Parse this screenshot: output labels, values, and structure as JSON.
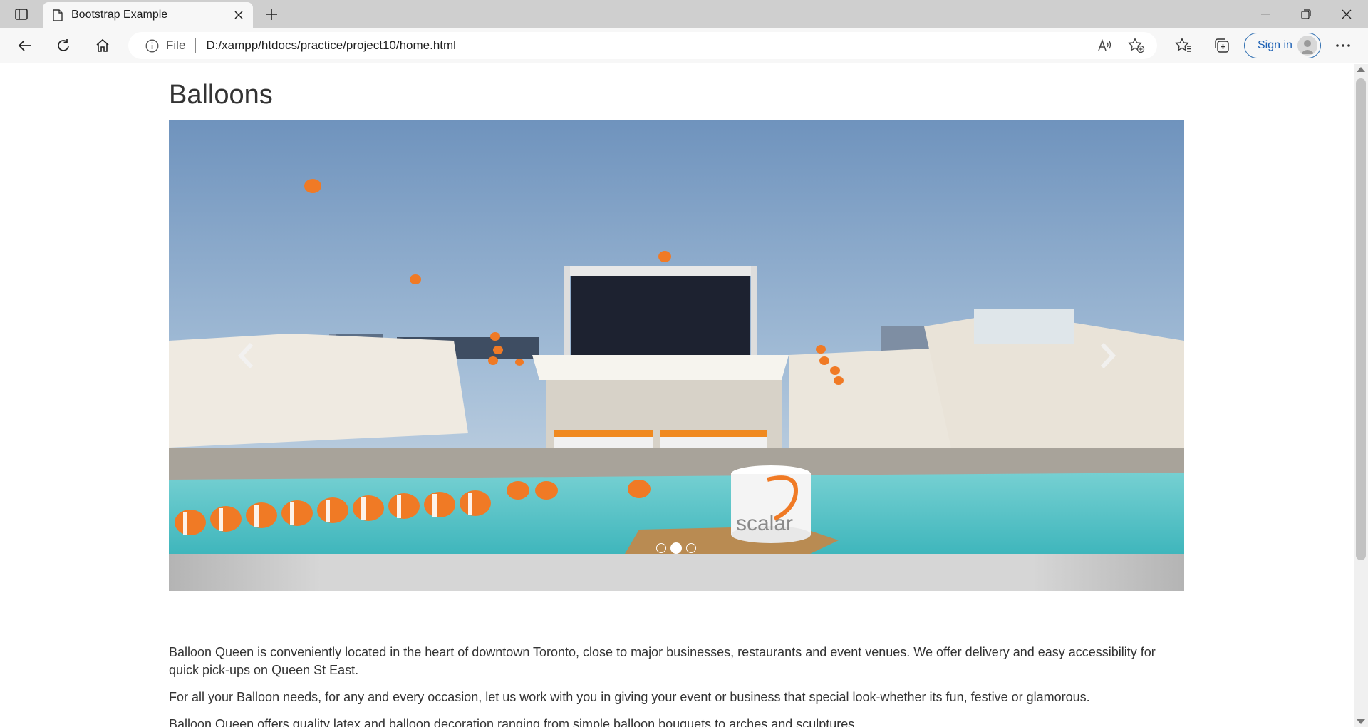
{
  "browser": {
    "tab_title": "Bootstrap Example",
    "address_label": "File",
    "url": "D:/xampp/htdocs/practice/project10/home.html",
    "signin_label": "Sign in"
  },
  "page": {
    "title": "Balloons",
    "carousel": {
      "active_index": 1,
      "slide_count": 3,
      "image_text": "scalar"
    },
    "paragraphs": [
      "Balloon Queen is conveniently located in the heart of downtown Toronto, close to major businesses, restaurants and event venues. We offer delivery and easy accessibility for quick pick-ups on Queen St East.",
      "For all your Balloon needs, for any and every occasion, let us work with you in giving your event or business that special look-whether its fun, festive or glamorous.",
      "Balloon Queen offers quality latex and balloon decoration ranging from simple balloon bouquets to arches and sculptures."
    ]
  },
  "colors": {
    "accent": "#1a5fb4",
    "balloon": "#f07a25",
    "pool": "#5cc6c8",
    "sky": "#88a9c9"
  }
}
